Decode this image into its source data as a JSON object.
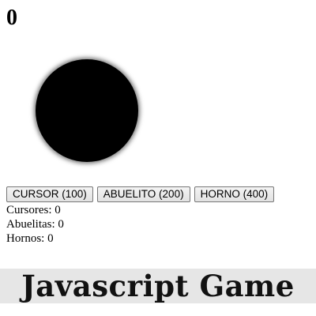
{
  "game": {
    "score": "0"
  },
  "shop": {
    "buttons": [
      {
        "label": "CURSOR (100)"
      },
      {
        "label": "ABUELITO (200)"
      },
      {
        "label": "HORNO (400)"
      }
    ]
  },
  "stats": {
    "cursores": "Cursores: 0",
    "abuelitas": "Abuelitas: 0",
    "hornos": "Hornos: 0"
  },
  "banner": {
    "title": "Javascript Game"
  },
  "colors": {
    "cookie": "#000000",
    "banner_bg": "#e6e6e6",
    "button_bg": "#efefef"
  }
}
